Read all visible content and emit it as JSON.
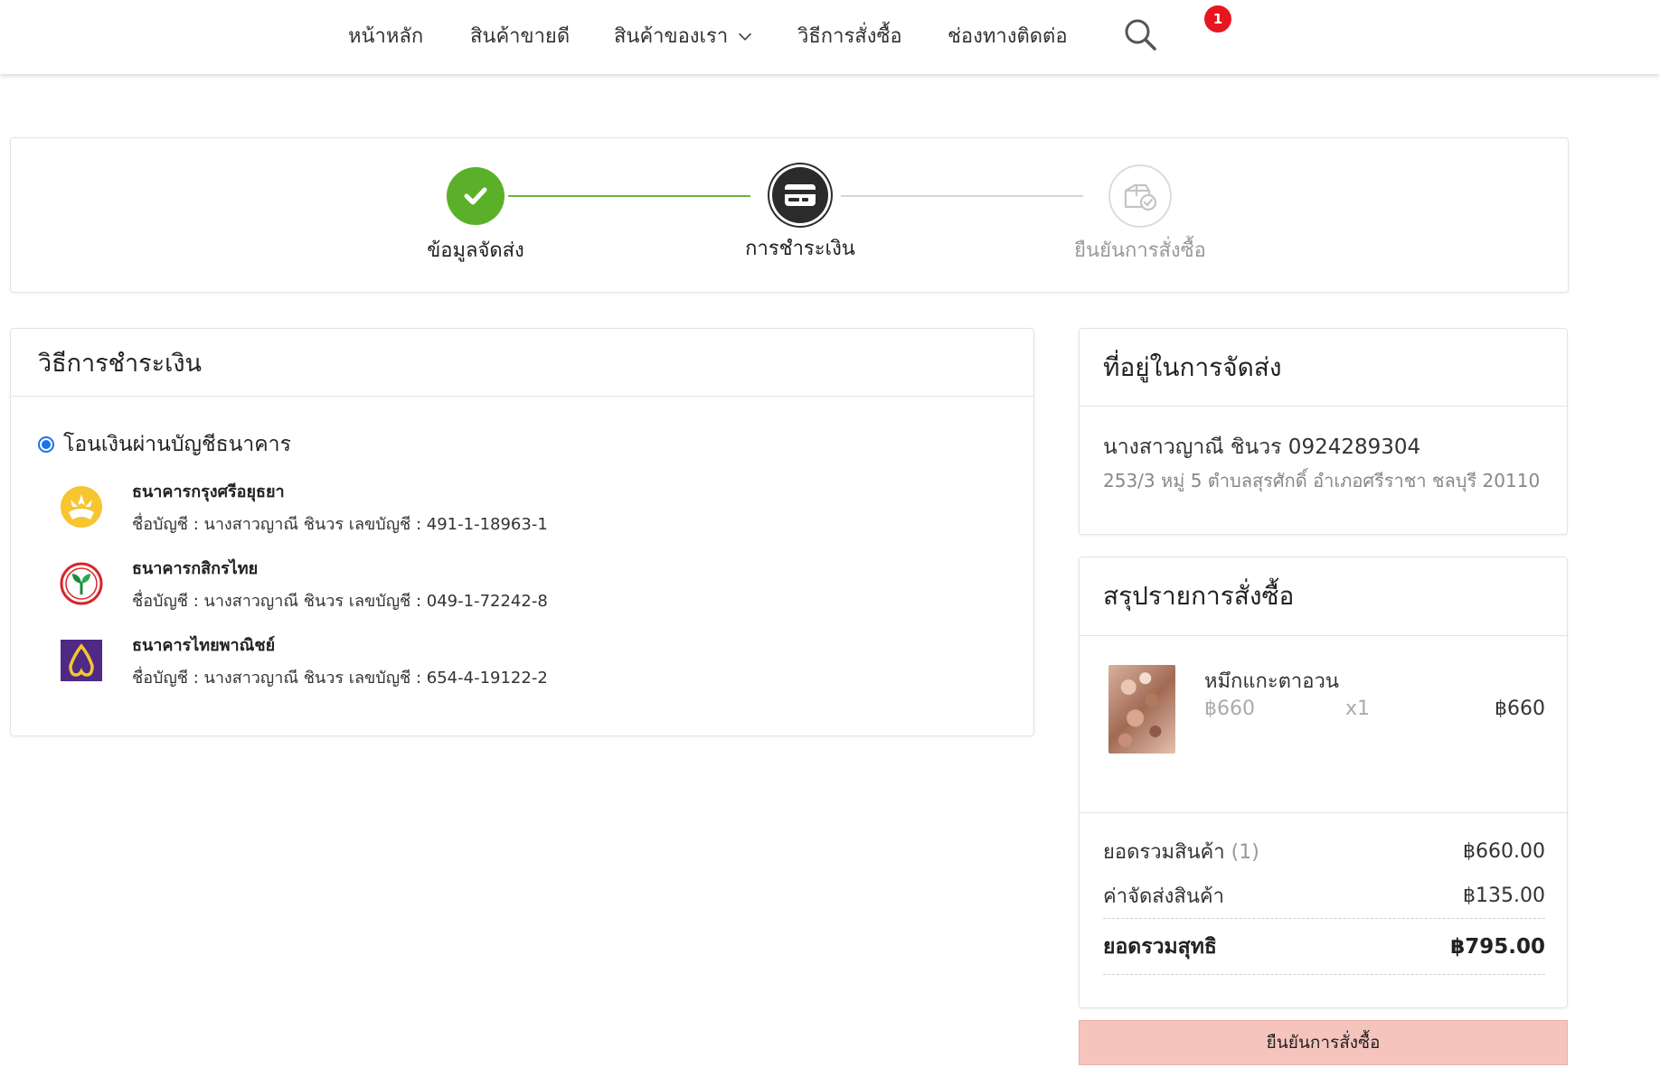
{
  "nav": {
    "items": [
      {
        "label": "หน้าหลัก"
      },
      {
        "label": "สินค้าขายดี"
      },
      {
        "label": "สินค้าของเรา"
      },
      {
        "label": "วิธีการสั่งซื้อ"
      },
      {
        "label": "ช่องทางติดต่อ"
      }
    ],
    "cart_count": "1",
    "icons": {
      "search": "search-icon",
      "cart": "cart-icon",
      "dropdown": "chevron-down-icon"
    }
  },
  "stepper": {
    "steps": [
      {
        "label": "ข้อมูลจัดส่ง",
        "state": "done",
        "icon": "check-icon"
      },
      {
        "label": "การชำระเงิน",
        "state": "active",
        "icon": "credit-card-icon"
      },
      {
        "label": "ยืนยันการสั่งซื้อ",
        "state": "pending",
        "icon": "package-check-icon"
      }
    ]
  },
  "payment": {
    "title": "วิธีการชำระเงิน",
    "option_label": "โอนเงินผ่านบัญชีธนาคาร",
    "banks": [
      {
        "name": "ธนาคารกรุงศรีอยุธยา",
        "account": "ชื่อบัญชี : นางสาวญาณี ชินวร เลขบัญชี : 491-1-18963-1",
        "logo": "krungsri-logo"
      },
      {
        "name": "ธนาคารกสิกรไทย",
        "account": "ชื่อบัญชี : นางสาวญาณี ชินวร เลขบัญชี : 049-1-72242-8",
        "logo": "kasikorn-logo"
      },
      {
        "name": "ธนาคารไทยพาณิชย์",
        "account": "ชื่อบัญชี : นางสาวญาณี ชินวร เลขบัญชี : 654-4-19122-2",
        "logo": "scb-logo"
      }
    ]
  },
  "address": {
    "title": "ที่อยู่ในการจัดส่ง",
    "name_phone": "นางสาวญาณี ชินวร 0924289304",
    "line": "253/3 หมู่ 5 ตำบลสุรศักดิ์ อำเภอศรีราชา ชลบุรี 20110"
  },
  "summary": {
    "title": "สรุปรายการสั่งซื้อ",
    "product": {
      "name": "หมึกแกะตาอวน",
      "price": "฿660",
      "qty": "x1",
      "total": "฿660"
    },
    "subtotal_label": "ยอดรวมสินค้า",
    "subtotal_count": "(1)",
    "subtotal_value": "฿660.00",
    "shipping_label": "ค่าจัดส่งสินค้า",
    "shipping_value": "฿135.00",
    "net_label": "ยอดรวมสุทธิ",
    "net_value": "฿795.00"
  },
  "confirm_button": "ยืนยันการสั่งซื้อ",
  "colors": {
    "accent_green": "#5bb02a",
    "active_dark": "#2b2b2b",
    "radio_blue": "#1a73e8",
    "badge_red": "#e8151f",
    "confirm_bg": "#f5c4bd"
  }
}
